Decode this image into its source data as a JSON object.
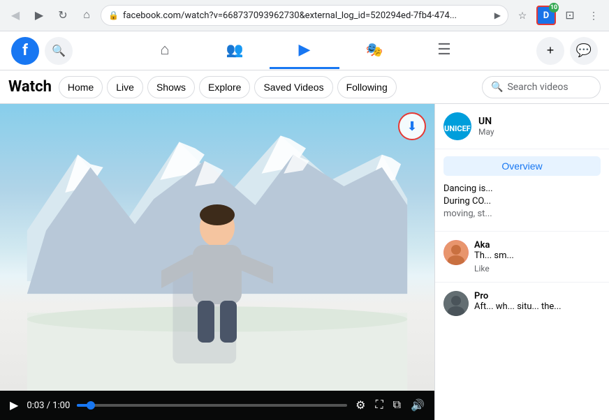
{
  "browser": {
    "back_btn": "◀",
    "forward_btn": "▶",
    "refresh_btn": "↻",
    "home_btn": "⌂",
    "address": "facebook.com/watch?v=668737093962730&external_log_id=520294ed-7fb4-474...",
    "star_btn": "☆",
    "extension_label": "D",
    "extension_badge": "10",
    "cast_btn": "⊡",
    "more_btn": "⋮"
  },
  "fb_nav": {
    "logo": "f",
    "home_icon": "⌂",
    "friends_icon": "👥",
    "watch_icon": "▶",
    "groups_icon": "🎭",
    "menu_icon": "☰",
    "plus_btn": "+",
    "messenger_icon": "💬"
  },
  "watch_bar": {
    "title": "Watch",
    "home_label": "Home",
    "live_label": "Live",
    "shows_label": "Shows",
    "explore_label": "Explore",
    "saved_label": "Saved Videos",
    "following_label": "Following",
    "search_placeholder": "Search videos"
  },
  "video": {
    "time_current": "0:03",
    "time_total": "1:00",
    "download_icon": "⬇"
  },
  "sidebar": {
    "channel_name": "UN",
    "channel_date": "May",
    "overview_label": "Overview",
    "desc_line1": "Dancing is...",
    "desc_line2": "During CO...",
    "desc_line2_cont": "moving, st...",
    "comment1_name": "Aka",
    "comment1_text": "Th... sm...",
    "comment1_like": "Like",
    "comment2_name": "Pro",
    "comment2_text": "Aft... wh... situ... the..."
  }
}
